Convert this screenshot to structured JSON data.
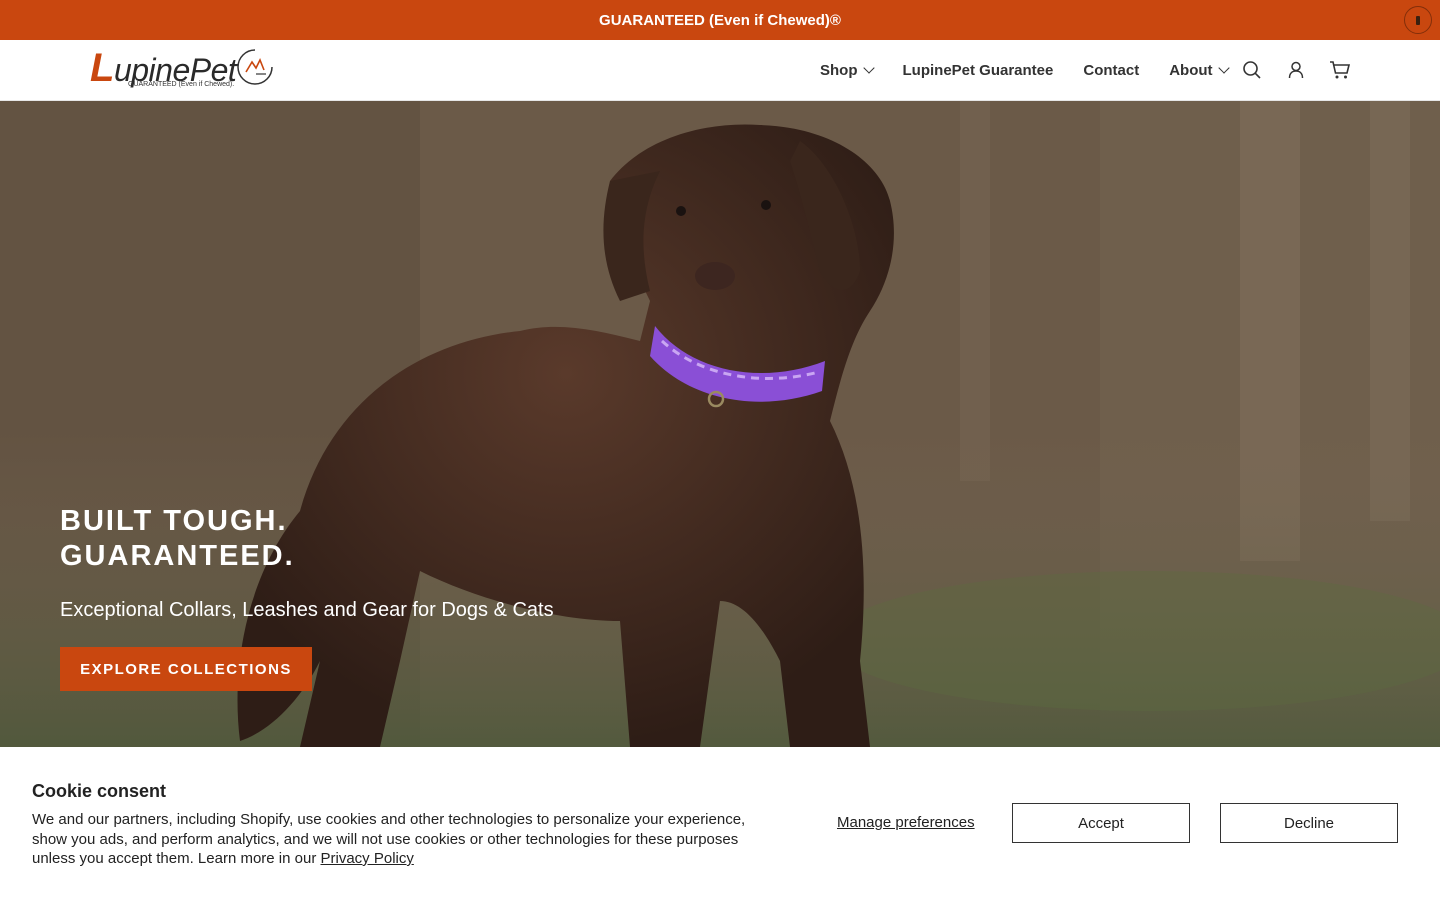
{
  "announcement": {
    "text": "GUARANTEED (Even if Chewed)®"
  },
  "logo": {
    "brand": "LupinePet",
    "tagline": "GUARANTEED (Even if Chewed)."
  },
  "nav": {
    "items": [
      {
        "label": "Shop",
        "has_dropdown": true
      },
      {
        "label": "LupinePet Guarantee",
        "has_dropdown": false
      },
      {
        "label": "Contact",
        "has_dropdown": false
      },
      {
        "label": "About",
        "has_dropdown": true
      }
    ],
    "icons": [
      "search-icon",
      "account-icon",
      "cart-icon"
    ]
  },
  "hero": {
    "title_line1": "BUILT TOUGH.",
    "title_line2": "GUARANTEED.",
    "subtitle": "Exceptional Collars, Leashes and Gear for Dogs & Cats",
    "cta": "EXPLORE COLLECTIONS"
  },
  "cookie": {
    "title": "Cookie consent",
    "text": "We and our partners, including Shopify, use cookies and other technologies to personalize your experience, show you ads, and perform analytics, and we will not use cookies or other technologies for these purposes unless you accept them. Learn more in our",
    "link": "Privacy Policy",
    "manage": "Manage preferences",
    "accept": "Accept",
    "decline": "Decline"
  },
  "colors": {
    "brand": "#c9470f",
    "collar": "#8a4fd6"
  }
}
